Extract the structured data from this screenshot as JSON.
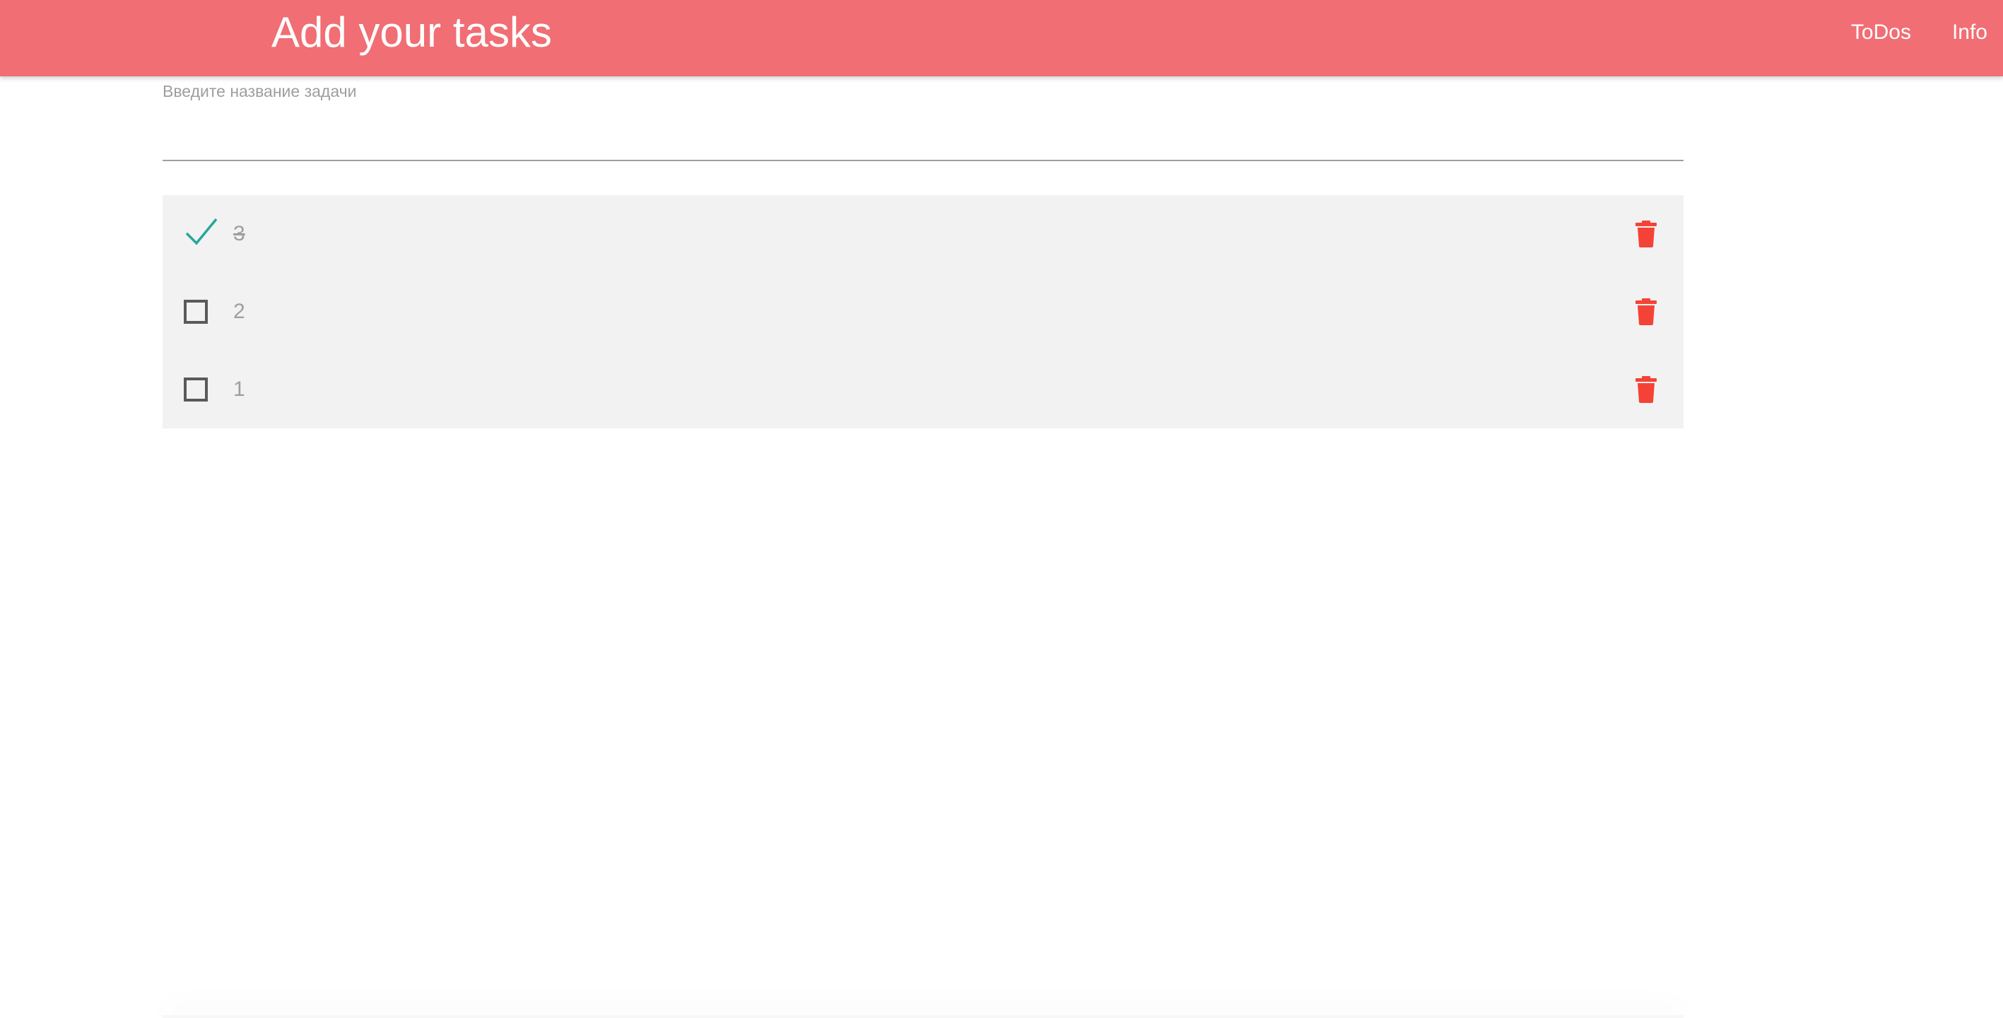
{
  "header": {
    "title": "Add your tasks",
    "nav": [
      {
        "label": "ToDos"
      },
      {
        "label": "Info"
      }
    ],
    "background_color": "#f06e74"
  },
  "task_input": {
    "label": "Введите название задачи",
    "value": ""
  },
  "tasks": [
    {
      "text": "3",
      "done": true,
      "checkbox_icon": "checkmark-icon",
      "delete_icon": "trash-icon"
    },
    {
      "text": "2",
      "done": false,
      "checkbox_icon": "checkbox-empty-icon",
      "delete_icon": "trash-icon"
    },
    {
      "text": "1",
      "done": false,
      "checkbox_icon": "checkbox-empty-icon",
      "delete_icon": "trash-icon"
    }
  ],
  "colors": {
    "checkmark": "#26a69a",
    "delete": "#f44336",
    "list_background": "#f2f2f2"
  }
}
